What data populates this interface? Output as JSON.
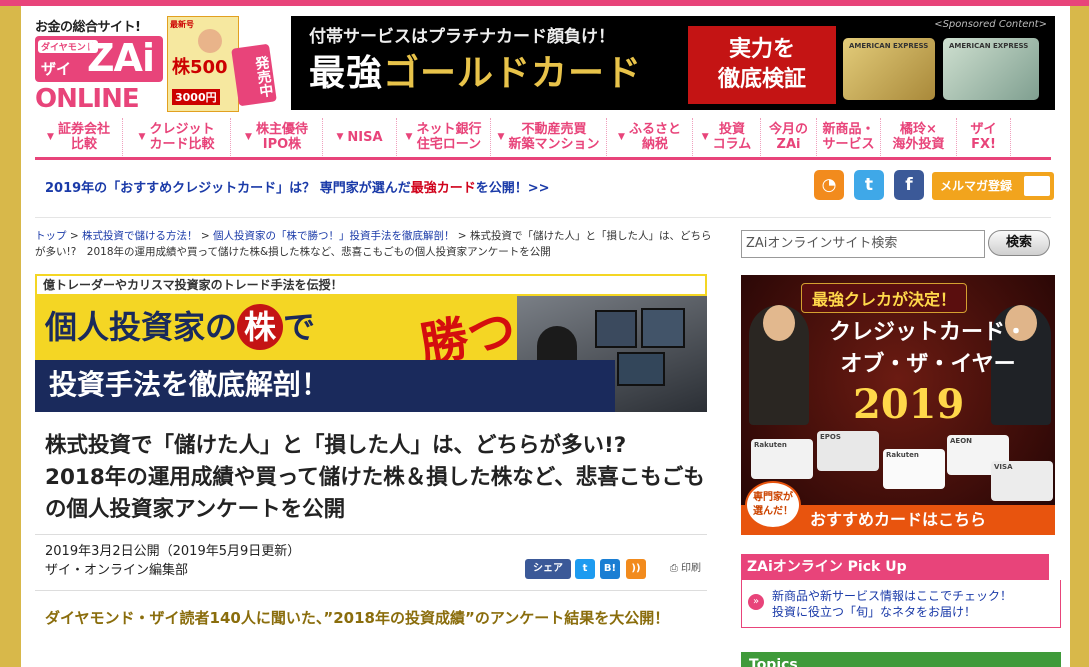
{
  "header": {
    "tagline": "お金の総合サイト!",
    "logo": {
      "top": "ダイヤモンド",
      "zai_kana": "ザイ",
      "zai": "ZAi",
      "online": "ONLINE"
    },
    "magazine": {
      "line1": "最新号",
      "big": "株500",
      "price": "3000円"
    },
    "on_sale": "発売中",
    "ad": {
      "sponsored": "<Sponsored Content>",
      "line1": "付帯サービスはプラチナカード顔負け！",
      "line2_prefix": "最強",
      "line2_main": "ゴールドカード",
      "red_box": "実力を\n徹底検証",
      "card1_text": "AMERICAN EXPRESS",
      "card2_text": "AMERICAN EXPRESS"
    }
  },
  "nav": {
    "items": [
      {
        "label": "証券会社\n比較",
        "arrow": true
      },
      {
        "label": "クレジット\nカード比較",
        "arrow": true
      },
      {
        "label": "株主優待\nIPO株",
        "arrow": true
      },
      {
        "label": "NISA",
        "arrow": true
      },
      {
        "label": "ネット銀行\n住宅ローン",
        "arrow": true
      },
      {
        "label": "不動産売買\n新築マンション",
        "arrow": true
      },
      {
        "label": "ふるさと\n納税",
        "arrow": true
      },
      {
        "label": "投資\nコラム",
        "arrow": true
      },
      {
        "label": "今月の\nZAi",
        "arrow": false
      },
      {
        "label": "新商品・\nサービス",
        "arrow": false
      },
      {
        "label": "橘玲×\n海外投資",
        "arrow": false
      },
      {
        "label": "ザイ\nFX!",
        "arrow": false
      }
    ]
  },
  "promo": {
    "part1": "2019年の「おすすめクレジットカード」は？ 専門家が選んだ",
    "part2": "最強カード",
    "part3": "を公開！>>"
  },
  "social": {
    "rss": "RSS",
    "twitter": "t",
    "facebook": "f",
    "mail": "メルマガ登録"
  },
  "breadcrumb": {
    "items": [
      "トップ",
      "株式投資で儲ける方法！",
      "個人投資家の「株で勝つ！」投資手法を徹底解剖！"
    ],
    "sep": " > ",
    "current": "株式投資で「儲けた人」と「損した人」は、どちらが多い!?　2018年の運用成績や買って儲けた株&損した株など、悲喜こもごもの個人投資家アンケートを公開"
  },
  "hero": {
    "topline": "億トレーダーやカリスマ投資家のトレード手法を伝授！",
    "row2_a": "個人投資家の",
    "kabu": "株",
    "row2_b": "で",
    "katsu": "勝つ",
    "row3": "投資手法を徹底解剖！"
  },
  "article": {
    "title": "株式投資で「儲けた人」と「損した人」は、どちらが多い!?　2018年の運用成績や買って儲けた株＆損した株など、悲喜こもごもの個人投資家アンケートを公開",
    "published": "2019年3月2日公開（2019年5月9日更新）",
    "author": "ザイ・オンライン編集部",
    "share": {
      "fb": "シェア",
      "tw": "t",
      "hb": "B!",
      "rss": "))",
      "print": "印刷"
    },
    "lead": "ダイヤモンド・ザイ読者140人に聞いた、”2018年の投資成績”のアンケート結果を大公開！"
  },
  "sidebar": {
    "search_placeholder": "ZAiオンラインサイト検索",
    "search_button": "検索",
    "ad": {
      "badge_top": "最強クレカが決定！",
      "title": "クレジットカード・\nオブ・ザ・イヤー",
      "year": "2019",
      "expert": "専門家が\n選んだ！",
      "cta": "おすすめカードはこちら",
      "cards": [
        "Rakuten",
        "EPOS",
        "Rakuten",
        "AEON",
        "VISA"
      ]
    },
    "pickup": {
      "heading": "ZAiオンライン Pick Up",
      "icon": "»",
      "line1": "新商品や新サービス情報はここでチェック！",
      "line2": "投資に役立つ「旬」なネタをお届け！"
    },
    "topics": "Topics"
  },
  "colors": {
    "brand_pink": "#e8447a",
    "link_blue": "#1a3aa8",
    "lead_gold": "#8a6d0c",
    "page_bg": "#d8b84a"
  }
}
